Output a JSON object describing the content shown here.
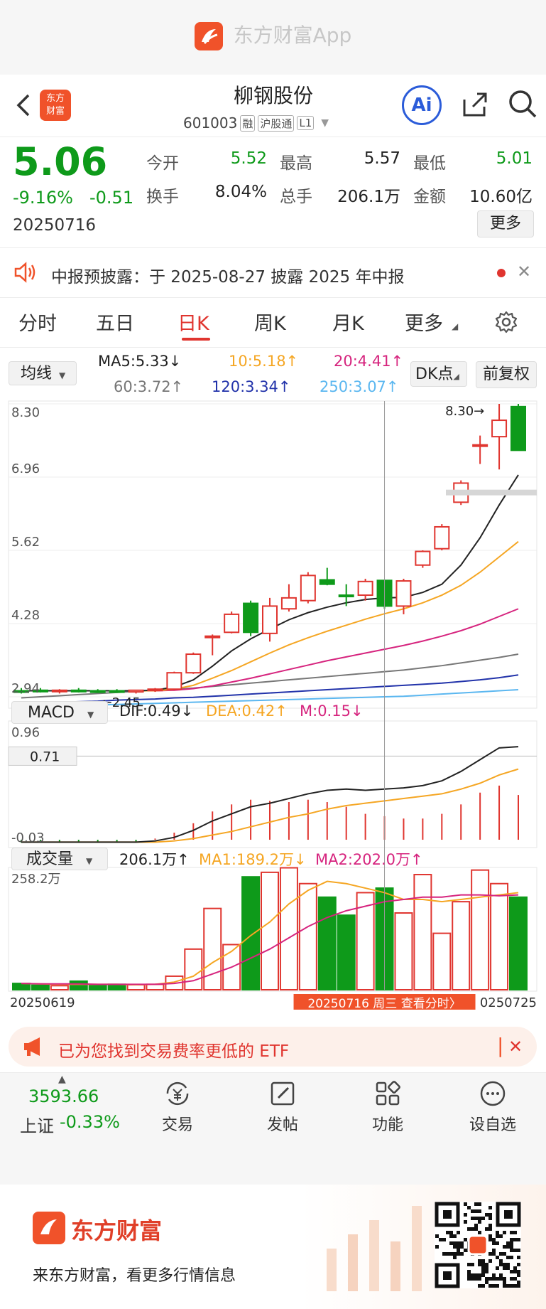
{
  "app": {
    "brand": "东方财富App"
  },
  "stock": {
    "name": "柳钢股份",
    "code": "601003",
    "tags": [
      "融",
      "沪股通",
      "L1"
    ],
    "price": "5.06",
    "change_pct": "-9.16%",
    "change": "-0.51",
    "date": "20250716",
    "stats": [
      {
        "label": "今开",
        "value": "5.52"
      },
      {
        "label": "最高",
        "value": "5.57"
      },
      {
        "label": "最低",
        "value": "5.01"
      },
      {
        "label": "换手",
        "value": "8.04%"
      },
      {
        "label": "总手",
        "value": "206.1万"
      },
      {
        "label": "金额",
        "value": "10.60亿"
      }
    ],
    "more_label": "更多"
  },
  "notice": {
    "text": "中报预披露：于 2025-08-27 披露 2025 年中报"
  },
  "tabs": [
    "分时",
    "五日",
    "日K",
    "周K",
    "月K",
    "更多"
  ],
  "active_tab": 2,
  "ma_bar": {
    "selector": "均线",
    "items": [
      {
        "text": "MA5:5.33↓",
        "color": "#222222"
      },
      {
        "text": "10:5.18↑",
        "color": "#f5a623"
      },
      {
        "text": "20:4.41↑",
        "color": "#d6247e"
      },
      {
        "text": "60:3.72↑",
        "color": "#777777"
      },
      {
        "text": "120:3.34↑",
        "color": "#2233aa"
      },
      {
        "text": "250:3.07↑",
        "color": "#5bb7f0"
      }
    ],
    "dk_label": "DK点",
    "adjust_label": "前复权"
  },
  "macd_bar": {
    "selector": "MACD",
    "items": [
      {
        "text": "DIF:0.49↓",
        "color": "#222222"
      },
      {
        "text": "DEA:0.42↑",
        "color": "#f5a623"
      },
      {
        "text": "M:0.15↓",
        "color": "#d6247e"
      }
    ]
  },
  "vol_bar": {
    "selector": "成交量",
    "items": [
      {
        "text": "206.1万↑",
        "color": "#222222"
      },
      {
        "text": "MA1:189.2万↓",
        "color": "#f5a623"
      },
      {
        "text": "MA2:202.0万↑",
        "color": "#d6247e"
      }
    ]
  },
  "chart_data": {
    "type": "candlestick",
    "price_axis_labels": [
      "8.30",
      "6.96",
      "5.62",
      "4.28",
      "2.94"
    ],
    "ylim": [
      2.94,
      8.3
    ],
    "high_annotation": "8.30",
    "low_annotation": "2.45",
    "macd_axis_labels": [
      "0.96",
      "-0.03"
    ],
    "macd_crosshair_value": "0.71",
    "volume_axis_label": "258.2万",
    "x_start_label": "20250619",
    "x_end_label": "0250725",
    "crosshair_label": "20250716 周三 查看分时",
    "candles": [
      {
        "o": 3.05,
        "h": 3.1,
        "l": 3.0,
        "c": 3.04,
        "v": 14
      },
      {
        "o": 3.06,
        "h": 3.1,
        "l": 3.02,
        "c": 3.05,
        "v": 10
      },
      {
        "o": 3.04,
        "h": 3.08,
        "l": 3.0,
        "c": 3.06,
        "v": 9
      },
      {
        "o": 3.06,
        "h": 3.1,
        "l": 3.02,
        "c": 3.05,
        "v": 19
      },
      {
        "o": 3.05,
        "h": 3.08,
        "l": 3.01,
        "c": 3.04,
        "v": 10
      },
      {
        "o": 3.05,
        "h": 3.08,
        "l": 3.01,
        "c": 3.03,
        "v": 12
      },
      {
        "o": 3.03,
        "h": 3.07,
        "l": 3.0,
        "c": 3.06,
        "v": 11
      },
      {
        "o": 3.06,
        "h": 3.1,
        "l": 3.03,
        "c": 3.08,
        "v": 12
      },
      {
        "o": 3.08,
        "h": 3.4,
        "l": 3.06,
        "c": 3.38,
        "v": 30
      },
      {
        "o": 3.38,
        "h": 3.75,
        "l": 3.36,
        "c": 3.72,
        "v": 90
      },
      {
        "o": 4.05,
        "h": 4.08,
        "l": 3.7,
        "c": 4.05,
        "v": 180
      },
      {
        "o": 4.12,
        "h": 4.5,
        "l": 4.1,
        "c": 4.45,
        "v": 100
      },
      {
        "o": 4.65,
        "h": 4.7,
        "l": 4.05,
        "c": 4.12,
        "v": 250
      },
      {
        "o": 4.1,
        "h": 4.75,
        "l": 3.95,
        "c": 4.6,
        "v": 260
      },
      {
        "o": 4.55,
        "h": 5.0,
        "l": 4.5,
        "c": 4.75,
        "v": 270
      },
      {
        "o": 4.7,
        "h": 5.22,
        "l": 4.65,
        "c": 5.16,
        "v": 235
      },
      {
        "o": 5.08,
        "h": 5.3,
        "l": 4.98,
        "c": 5.0,
        "v": 205
      },
      {
        "o": 4.8,
        "h": 5.0,
        "l": 4.6,
        "c": 4.79,
        "v": 165
      },
      {
        "o": 4.8,
        "h": 5.1,
        "l": 4.7,
        "c": 5.05,
        "v": 215
      },
      {
        "o": 5.07,
        "h": 5.07,
        "l": 4.55,
        "c": 4.6,
        "v": 225
      },
      {
        "o": 4.6,
        "h": 5.1,
        "l": 4.45,
        "c": 5.06,
        "v": 170
      },
      {
        "o": 5.35,
        "h": 5.62,
        "l": 5.3,
        "c": 5.6,
        "v": 255
      },
      {
        "o": 5.65,
        "h": 6.1,
        "l": 5.62,
        "c": 6.05,
        "v": 125
      },
      {
        "o": 6.5,
        "h": 6.9,
        "l": 6.45,
        "c": 6.85,
        "v": 195
      },
      {
        "o": 7.55,
        "h": 7.72,
        "l": 7.2,
        "c": 7.55,
        "v": 265
      },
      {
        "o": 7.7,
        "h": 8.3,
        "l": 7.1,
        "c": 8.0,
        "v": 235
      },
      {
        "o": 8.25,
        "h": 8.3,
        "l": 7.5,
        "c": 7.45,
        "v": 205
      }
    ],
    "ma5": [
      3.05,
      3.05,
      3.05,
      3.05,
      3.05,
      3.05,
      3.05,
      3.06,
      3.12,
      3.25,
      3.5,
      3.78,
      4.0,
      4.18,
      4.35,
      4.48,
      4.58,
      4.66,
      4.72,
      4.75,
      4.76,
      4.85,
      5.0,
      5.35,
      5.85,
      6.45,
      7.0
    ],
    "ma10": [
      3.05,
      3.05,
      3.05,
      3.05,
      3.05,
      3.05,
      3.05,
      3.05,
      3.08,
      3.15,
      3.28,
      3.42,
      3.58,
      3.74,
      3.89,
      4.02,
      4.14,
      4.25,
      4.36,
      4.46,
      4.55,
      4.66,
      4.8,
      4.98,
      5.22,
      5.5,
      5.78
    ],
    "ma20": [
      3.05,
      3.05,
      3.05,
      3.05,
      3.05,
      3.05,
      3.05,
      3.05,
      3.06,
      3.09,
      3.14,
      3.21,
      3.28,
      3.36,
      3.44,
      3.52,
      3.6,
      3.67,
      3.74,
      3.81,
      3.88,
      3.96,
      4.05,
      4.15,
      4.27,
      4.41,
      4.55
    ],
    "ma60": [
      2.92,
      2.94,
      2.96,
      2.98,
      3.0,
      3.02,
      3.04,
      3.06,
      3.08,
      3.1,
      3.13,
      3.16,
      3.19,
      3.22,
      3.25,
      3.28,
      3.31,
      3.34,
      3.37,
      3.4,
      3.43,
      3.47,
      3.51,
      3.56,
      3.61,
      3.66,
      3.72
    ],
    "ma120": [
      2.82,
      2.83,
      2.84,
      2.85,
      2.86,
      2.88,
      2.89,
      2.9,
      2.92,
      2.93,
      2.95,
      2.97,
      2.99,
      3.01,
      3.03,
      3.05,
      3.07,
      3.09,
      3.11,
      3.13,
      3.15,
      3.17,
      3.19,
      3.22,
      3.25,
      3.29,
      3.34
    ],
    "ma250": [
      2.75,
      2.76,
      2.77,
      2.78,
      2.79,
      2.8,
      2.81,
      2.82,
      2.83,
      2.84,
      2.85,
      2.86,
      2.87,
      2.88,
      2.89,
      2.9,
      2.91,
      2.92,
      2.93,
      2.94,
      2.95,
      2.97,
      2.99,
      3.01,
      3.03,
      3.05,
      3.07
    ],
    "dif": [
      -0.02,
      -0.02,
      -0.02,
      -0.02,
      -0.02,
      -0.02,
      -0.02,
      -0.01,
      0.02,
      0.08,
      0.16,
      0.22,
      0.28,
      0.31,
      0.35,
      0.39,
      0.42,
      0.43,
      0.42,
      0.43,
      0.44,
      0.46,
      0.5,
      0.58,
      0.68,
      0.78,
      0.79
    ],
    "dea": [
      -0.02,
      -0.02,
      -0.02,
      -0.02,
      -0.02,
      -0.02,
      -0.02,
      -0.02,
      -0.01,
      0.01,
      0.04,
      0.07,
      0.11,
      0.15,
      0.19,
      0.22,
      0.26,
      0.29,
      0.31,
      0.33,
      0.35,
      0.37,
      0.39,
      0.43,
      0.48,
      0.55,
      0.6
    ],
    "macd": [
      0.0,
      0.0,
      0.0,
      0.0,
      0.0,
      0.0,
      0.0,
      0.01,
      0.06,
      0.14,
      0.24,
      0.3,
      0.34,
      0.33,
      0.32,
      0.34,
      0.32,
      0.28,
      0.22,
      0.2,
      0.18,
      0.18,
      0.22,
      0.3,
      0.4,
      0.46,
      0.38
    ],
    "vol_ma1": [
      14,
      13,
      12,
      12,
      12,
      12,
      11,
      12,
      17,
      30,
      60,
      85,
      120,
      150,
      190,
      220,
      240,
      235,
      225,
      215,
      200,
      200,
      195,
      200,
      205,
      210,
      215
    ],
    "vol_ma2": [
      14,
      13,
      13,
      13,
      12,
      12,
      12,
      12,
      14,
      20,
      35,
      50,
      70,
      90,
      115,
      140,
      160,
      175,
      185,
      195,
      200,
      205,
      205,
      210,
      210,
      208,
      210
    ]
  },
  "etf_banner": {
    "text": "已为您找到交易费率更低的 ETF"
  },
  "index": {
    "value": "3593.66",
    "label": "上证",
    "change": "-0.33%"
  },
  "bottom_nav": [
    {
      "label": "交易",
      "icon": "trade-icon"
    },
    {
      "label": "发帖",
      "icon": "post-icon"
    },
    {
      "label": "功能",
      "icon": "grid-icon"
    },
    {
      "label": "设自选",
      "icon": "more-icon"
    }
  ],
  "promo": {
    "brand": "东方财富",
    "tagline": "来东方财富，看更多行情信息"
  }
}
